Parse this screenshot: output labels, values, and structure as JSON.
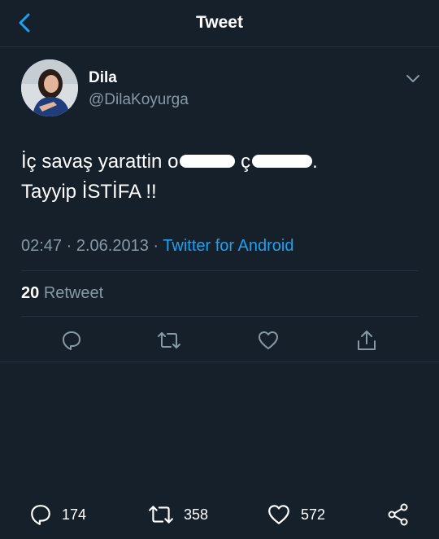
{
  "header": {
    "title": "Tweet",
    "back_icon": "back-chevron-icon"
  },
  "author": {
    "display_name": "Dila",
    "handle": "@DilaKoyurga"
  },
  "tweet": {
    "line1_visible_start": "İç savaş yarattin o",
    "line1_mid": "ç",
    "line1_end": ".",
    "line2": "Tayyip İSTİFA !!"
  },
  "meta": {
    "time": "02:47",
    "separator": "·",
    "date": "2.06.2013",
    "source": "Twitter for Android"
  },
  "stats": {
    "retweet_count": "20",
    "retweet_label": "Retweet"
  },
  "bottom_bar": {
    "replies": "174",
    "retweets": "358",
    "likes": "572"
  },
  "colors": {
    "background": "#15202b",
    "accent": "#1da1f2",
    "secondary_text": "#8899a6",
    "divider": "#253341"
  }
}
